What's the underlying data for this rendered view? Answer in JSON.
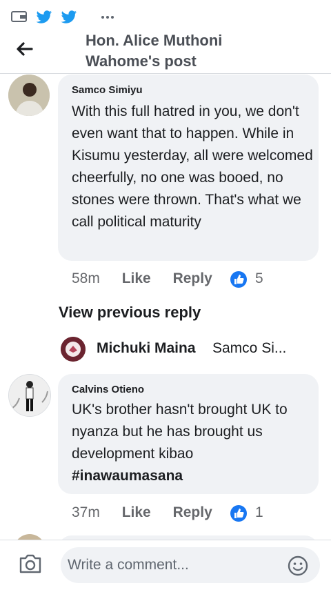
{
  "header": {
    "title_line1": "Hon. Alice Muthoni",
    "title_line2": "Wahome's post"
  },
  "comments": [
    {
      "author": "Samco Simiyu",
      "text": "With this full hatred in you, we don't even want that to happen. While in Kisumu yesterday, all were welcomed cheerfully, no one was booed, no stones were thrown. That's what we call political maturity",
      "time": "58m",
      "like_label": "Like",
      "reply_label": "Reply",
      "reaction_count": "5"
    },
    {
      "author": "Calvins Otieno",
      "text": "UK's brother hasn't brought UK to nyanza but he has brought us development kibao",
      "hashtag": "#inawaumasana",
      "time": "37m",
      "like_label": "Like",
      "reply_label": "Reply",
      "reaction_count": "1"
    }
  ],
  "view_previous_reply": "View previous reply",
  "reply_preview": {
    "author": "Michuki Maina",
    "snippet": "Samco Si..."
  },
  "composer": {
    "placeholder": "Write a comment..."
  },
  "colors": {
    "accent": "#1877f2",
    "bubble": "#f0f2f5",
    "meta_text": "#65676b"
  }
}
